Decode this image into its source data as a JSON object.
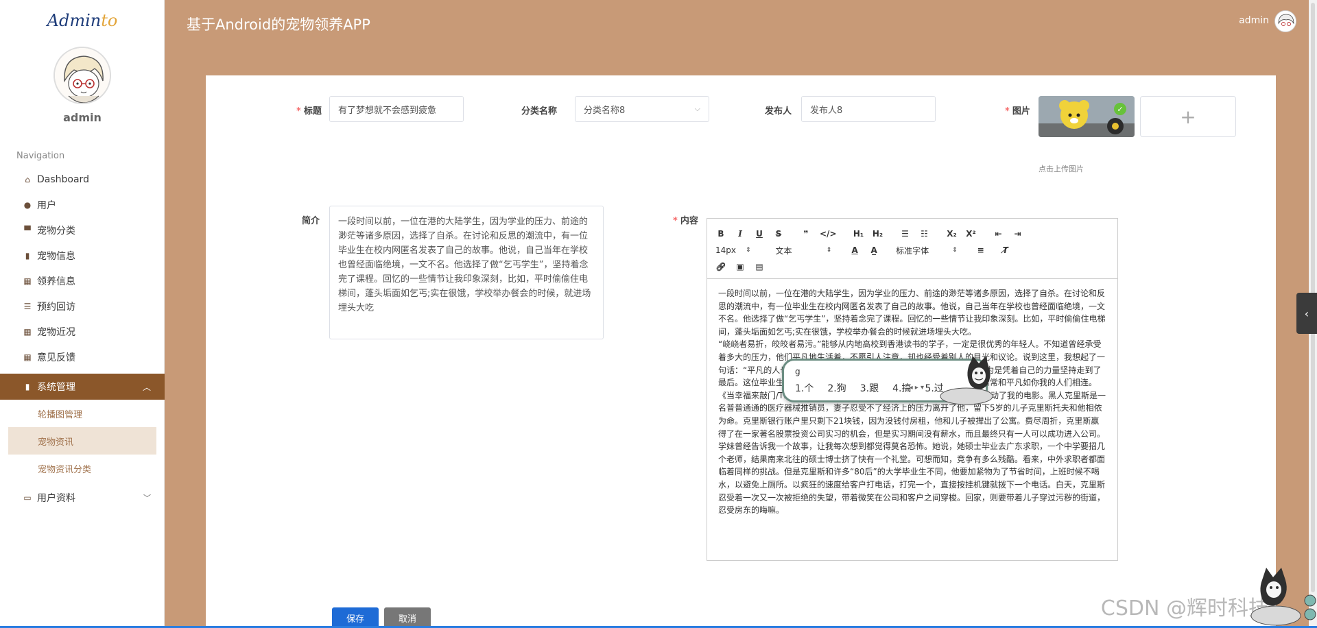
{
  "sidebar": {
    "logo_main": "Admin",
    "logo_accent": "to",
    "username": "admin",
    "nav_title": "Navigation",
    "items": [
      {
        "label": "Dashboard"
      },
      {
        "label": "用户"
      },
      {
        "label": "宠物分类"
      },
      {
        "label": "宠物信息"
      },
      {
        "label": "领养信息"
      },
      {
        "label": "预约回访"
      },
      {
        "label": "宠物近况"
      },
      {
        "label": "意见反馈"
      }
    ],
    "system_menu": {
      "label": "系统管理",
      "children": [
        {
          "label": "轮播图管理"
        },
        {
          "label": "宠物资讯"
        },
        {
          "label": "宠物资讯分类"
        }
      ]
    },
    "user_profile": {
      "label": "用户资料"
    }
  },
  "header": {
    "title": "基于Android的宠物领养APP",
    "username": "admin"
  },
  "form": {
    "title_label": "标题",
    "title_value": "有了梦想就不会感到疲惫",
    "category_label": "分类名称",
    "category_value": "分类名称8",
    "publisher_label": "发布人",
    "publisher_value": "发布人8",
    "image_label": "图片",
    "upload_hint": "点击上传图片",
    "intro_label": "简介",
    "intro_value": "一段时间以前，一位在港的大陆学生，因为学业的压力、前途的渺茫等诸多原因，选择了自杀。在讨论和反思的潮流中，有一位毕业生在校内网匿名发表了自己的故事。他说，自己当年在学校也曾经面临绝境，一文不名。他选择了做“乞丐学生”，坚持着念完了课程。回忆的一些情节让我印象深刻，比如，平时偷偷住电梯间，蓬头垢面如乞丐;实在很饿，学校举办餐会的时候，就进场埋头大吃",
    "content_label": "内容",
    "save_label": "保存",
    "cancel_label": "取消"
  },
  "editor": {
    "font_size": "14px",
    "format": "文本",
    "font_family": "标准字体",
    "paragraphs": [
      "一段时间以前，一位在港的大陆学生，因为学业的压力、前途的渺茫等诸多原因，选择了自杀。在讨论和反思的潮流中，有一位毕业生在校内网匿名发表了自己的故事。他说，自己当年在学校也曾经面临绝境，一文不名。他选择了做“乞丐学生”，坚持着念完了课程。回忆的一些情节让我印象深刻。比如，平时偷偷住电梯间，蓬头垢面如乞丐;实在很饿，学校举办餐会的时候就进场埋头大吃。",
      "“峣峣者易折，皎皎者易污。”能够从内地高校到香港读书的学子，一定是很优秀的年轻人。不知道曾经承受着多大的压力，他们平凡地生活着，不愿引人注意，却也经受着别人的目光和议论。说到这里，我想起了一句话：“平凡的人也有属于自己的梦想。”平凡之中蕴含着感动人的力量，因为是凭着自己的力量坚持走到了最后。这位毕业生当年面临的是无法想象的困难，其奋斗或者说挣扎，却常常和平凡如你我的人们相连。",
      "《当幸福来敲门/The Pursuit of Happyness》就是这样偶然被看到，又感动了我的电影。黑人克里斯是一名普普通通的医疗器械推销员，妻子忍受不了经济上的压力离开了他，留下5岁的儿子克里斯托夫和他相依为命。克里斯银行账户里只剩下21块钱，因为没钱付房租，他和儿子被撵出了公寓。费尽周折，克里斯赢得了在一家著名股票投资公司实习的机会，但是实习期间没有薪水，而且最终只有一人可以成功进入公司。",
      "学妹曾经告诉我一个故事，让我每次想到都觉得莫名恐怖。她说，她硕士毕业去广东求职，一个中学要招几个老师，结果南来北往的硕士博士挤了快有一个礼堂。可想而知，竞争有多么残酷。看来，中外求职者都面临着同样的挑战。但是克里斯和许多“80后”的大学毕业生不同，他要加紧物为了节省时间，上班时候不喝水，以避免上厕所。以疯狂的速度给客户打电话，打完一个，直接按挂机键就拨下一个电话。白天，克里斯忍受着一次又一次被拒绝的失望，带着微笑在公司和客户之间穿梭。回家，则要带着儿子穿过污秽的街道，忍受房东的晦嘛。"
    ]
  },
  "ime": {
    "typed": "g",
    "candidates": [
      "1.个",
      "2.狗",
      "3.跟",
      "4.搞",
      "5.过"
    ]
  },
  "watermark": "CSDN @辉时科技",
  "colors": {
    "background": "#c89a77",
    "sidebar_active": "#8b572a",
    "submenu_text": "#a0724c",
    "save_button": "#1e6bd6",
    "cancel_button": "#777777"
  }
}
